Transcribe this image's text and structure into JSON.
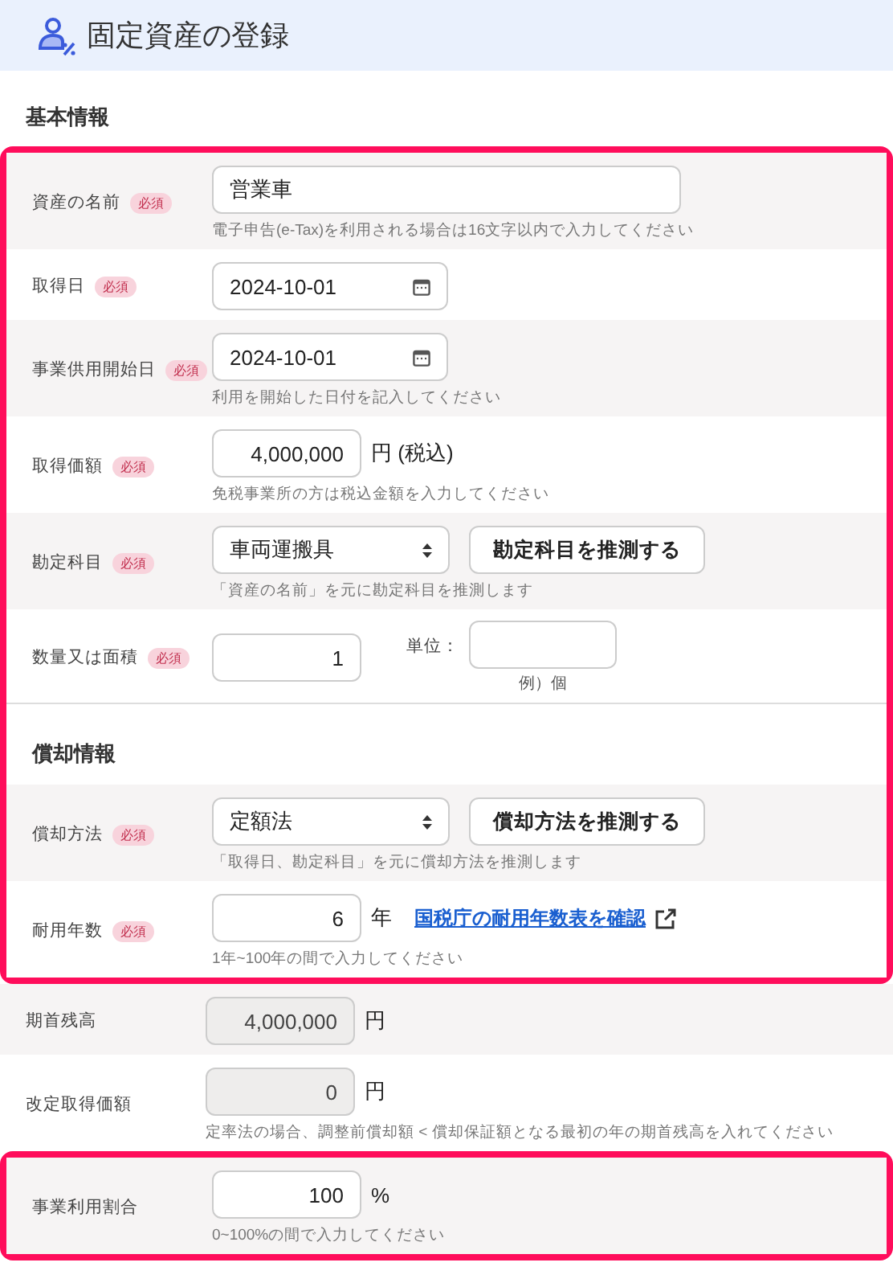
{
  "header": {
    "title": "固定資産の登録"
  },
  "blocks": [
    {
      "highlighted": false,
      "items": [
        {
          "kind": "heading",
          "text": "基本情報"
        }
      ]
    },
    {
      "highlighted": true,
      "items": [
        {
          "kind": "field",
          "label": "資産の名前",
          "badge": "必須",
          "input": {
            "kind": "text",
            "value": "営業車"
          },
          "hint": "電子申告(e-Tax)を利用される場合は16文字以内で入力してください"
        },
        {
          "kind": "field",
          "label": "取得日",
          "badge": "必須",
          "input": {
            "kind": "date",
            "value": "2024-10-01"
          }
        },
        {
          "kind": "field",
          "label": "事業供用開始日",
          "badge": "必須",
          "input": {
            "kind": "date",
            "value": "2024-10-01"
          },
          "hint": "利用を開始した日付を記入してください"
        },
        {
          "kind": "field",
          "label": "取得価額",
          "badge": "必須",
          "input": {
            "kind": "number",
            "value": "4,000,000"
          },
          "unit": "円 (税込)",
          "hint": "免税事業所の方は税込金額を入力してください"
        },
        {
          "kind": "field",
          "label": "勘定科目",
          "badge": "必須",
          "input": {
            "kind": "select",
            "value": "車両運搬具"
          },
          "button": "勘定科目を推測する",
          "hint": "「資産の名前」を元に勘定科目を推測します"
        },
        {
          "kind": "field",
          "label": "数量又は面積",
          "badge": "必須",
          "input": {
            "kind": "number",
            "value": "1"
          },
          "extra": {
            "label": "単位：",
            "note": "例）個"
          }
        },
        {
          "kind": "heading",
          "text": "償却情報"
        },
        {
          "kind": "field",
          "label": "償却方法",
          "badge": "必須",
          "input": {
            "kind": "select",
            "value": "定額法"
          },
          "button": "償却方法を推測する",
          "hint": "「取得日、勘定科目」を元に償却方法を推測します"
        },
        {
          "kind": "field",
          "label": "耐用年数",
          "badge": "必須",
          "input": {
            "kind": "number",
            "value": "6"
          },
          "unit": "年",
          "link": "国税庁の耐用年数表を確認",
          "hint": "1年~100年の間で入力してください"
        }
      ]
    },
    {
      "highlighted": false,
      "items": [
        {
          "kind": "field",
          "label": "期首残高",
          "input": {
            "kind": "readonly",
            "value": "4,000,000"
          },
          "unit": "円"
        },
        {
          "kind": "field",
          "label": "改定取得価額",
          "input": {
            "kind": "readonly",
            "value": "0"
          },
          "unit": "円",
          "hint": "定率法の場合、調整前償却額 < 償却保証額となる最初の年の期首残高を入れてください"
        }
      ]
    },
    {
      "highlighted": true,
      "items": [
        {
          "kind": "field",
          "label": "事業利用割合",
          "input": {
            "kind": "number",
            "value": "100"
          },
          "unit": "%",
          "hint": "0~100%の間で入力してください"
        }
      ]
    }
  ]
}
